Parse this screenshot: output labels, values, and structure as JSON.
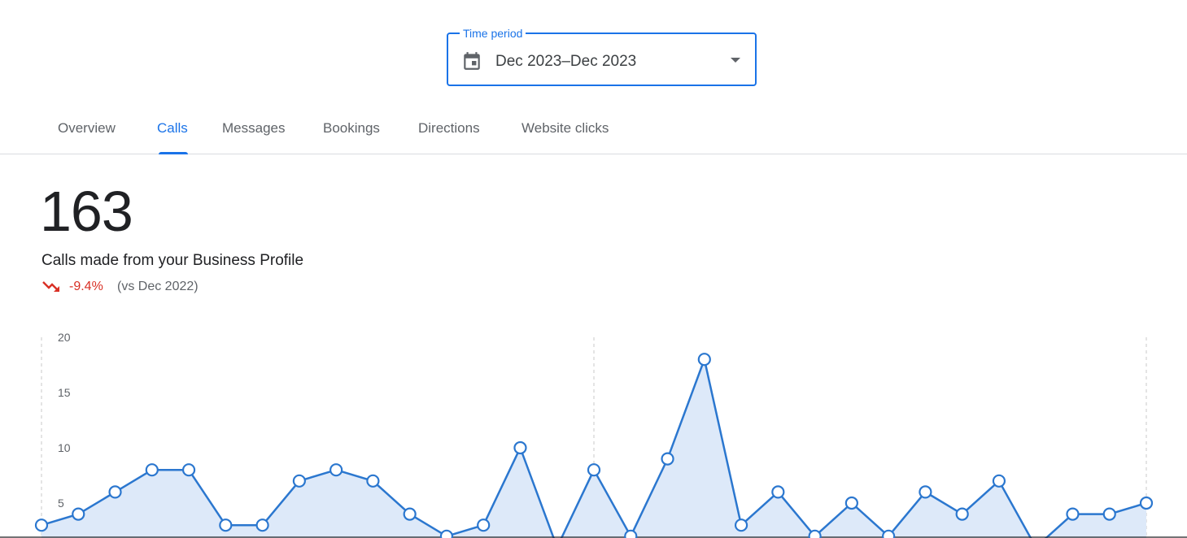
{
  "time_period": {
    "legend": "Time period",
    "value": "Dec 2023–Dec 2023",
    "icon": "calendar-icon"
  },
  "tabs": [
    {
      "label": "Overview",
      "active": false
    },
    {
      "label": "Calls",
      "active": true
    },
    {
      "label": "Messages",
      "active": false
    },
    {
      "label": "Bookings",
      "active": false
    },
    {
      "label": "Directions",
      "active": false
    },
    {
      "label": "Website clicks",
      "active": false
    }
  ],
  "metric": {
    "value": "163",
    "description": "Calls made from your Business Profile",
    "change_pct": "-9.4%",
    "change_context": "(vs Dec 2022)",
    "trend_icon": "trending-down-icon",
    "trend_color": "#d93025"
  },
  "colors": {
    "accent": "#1a73e8",
    "series_line": "#2b77cf",
    "series_fill": "#dde9f9"
  },
  "chart_data": {
    "type": "area",
    "ylim": [
      0,
      20
    ],
    "y_ticks": [
      5,
      10,
      15,
      20
    ],
    "grid": "vertical dashed",
    "x": [
      1,
      2,
      3,
      4,
      5,
      6,
      7,
      8,
      9,
      10,
      11,
      12,
      13,
      14,
      15,
      16,
      17,
      18,
      19,
      20,
      21,
      22,
      23,
      24,
      25,
      26,
      27,
      28,
      29,
      30,
      31
    ],
    "series": [
      {
        "values": [
          3,
          4,
          6,
          8,
          8,
          3,
          3,
          7,
          8,
          7,
          4,
          2,
          3,
          10,
          1,
          8,
          2,
          9,
          18,
          3,
          6,
          2,
          5,
          2,
          6,
          4,
          7,
          1,
          4,
          4,
          5
        ]
      }
    ]
  }
}
